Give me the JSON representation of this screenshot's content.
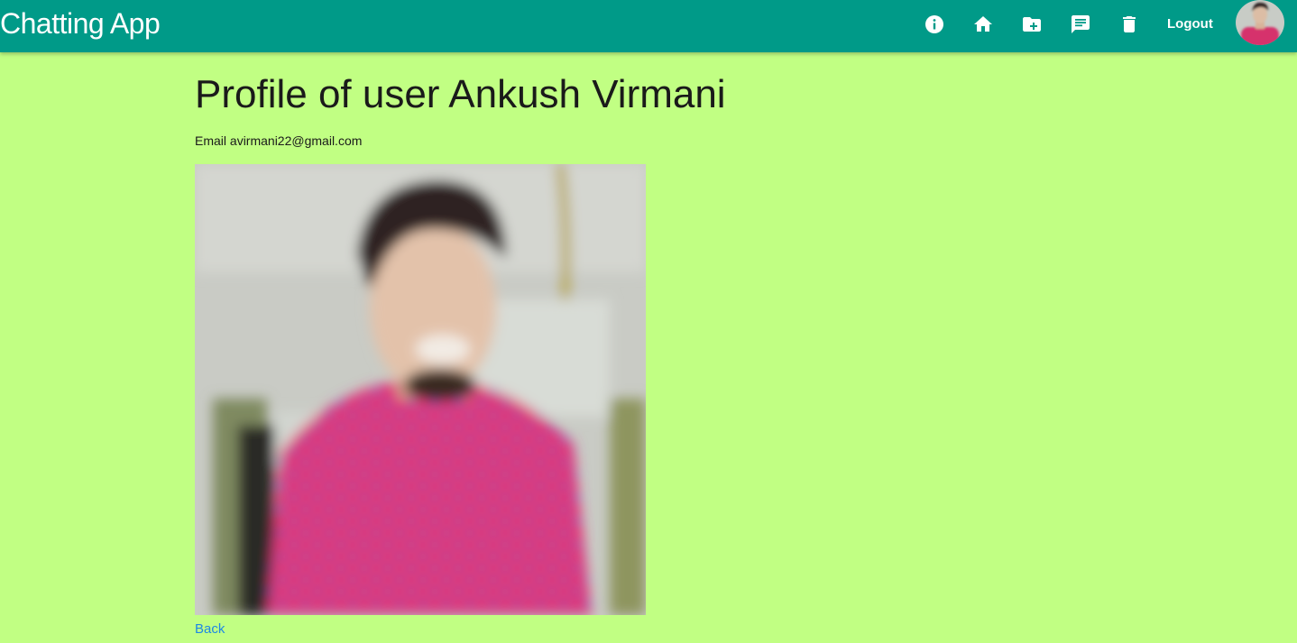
{
  "app": {
    "title": "Chatting App"
  },
  "nav": {
    "icons": [
      {
        "name": "info-icon"
      },
      {
        "name": "home-icon"
      },
      {
        "name": "create-folder-icon"
      },
      {
        "name": "chat-icon"
      },
      {
        "name": "delete-icon"
      }
    ],
    "logout_label": "Logout",
    "avatar_icon": "user-avatar"
  },
  "profile": {
    "title": "Profile of user Ankush Virmani",
    "email_label": "Email",
    "email": "avirmani22@gmail.com",
    "photo_icon": "profile-photo",
    "back_label": "Back"
  },
  "colors": {
    "navbar": "#009a88",
    "page_background": "#c1ff83",
    "link": "#1e88e5",
    "text": "#1a1a1a"
  }
}
